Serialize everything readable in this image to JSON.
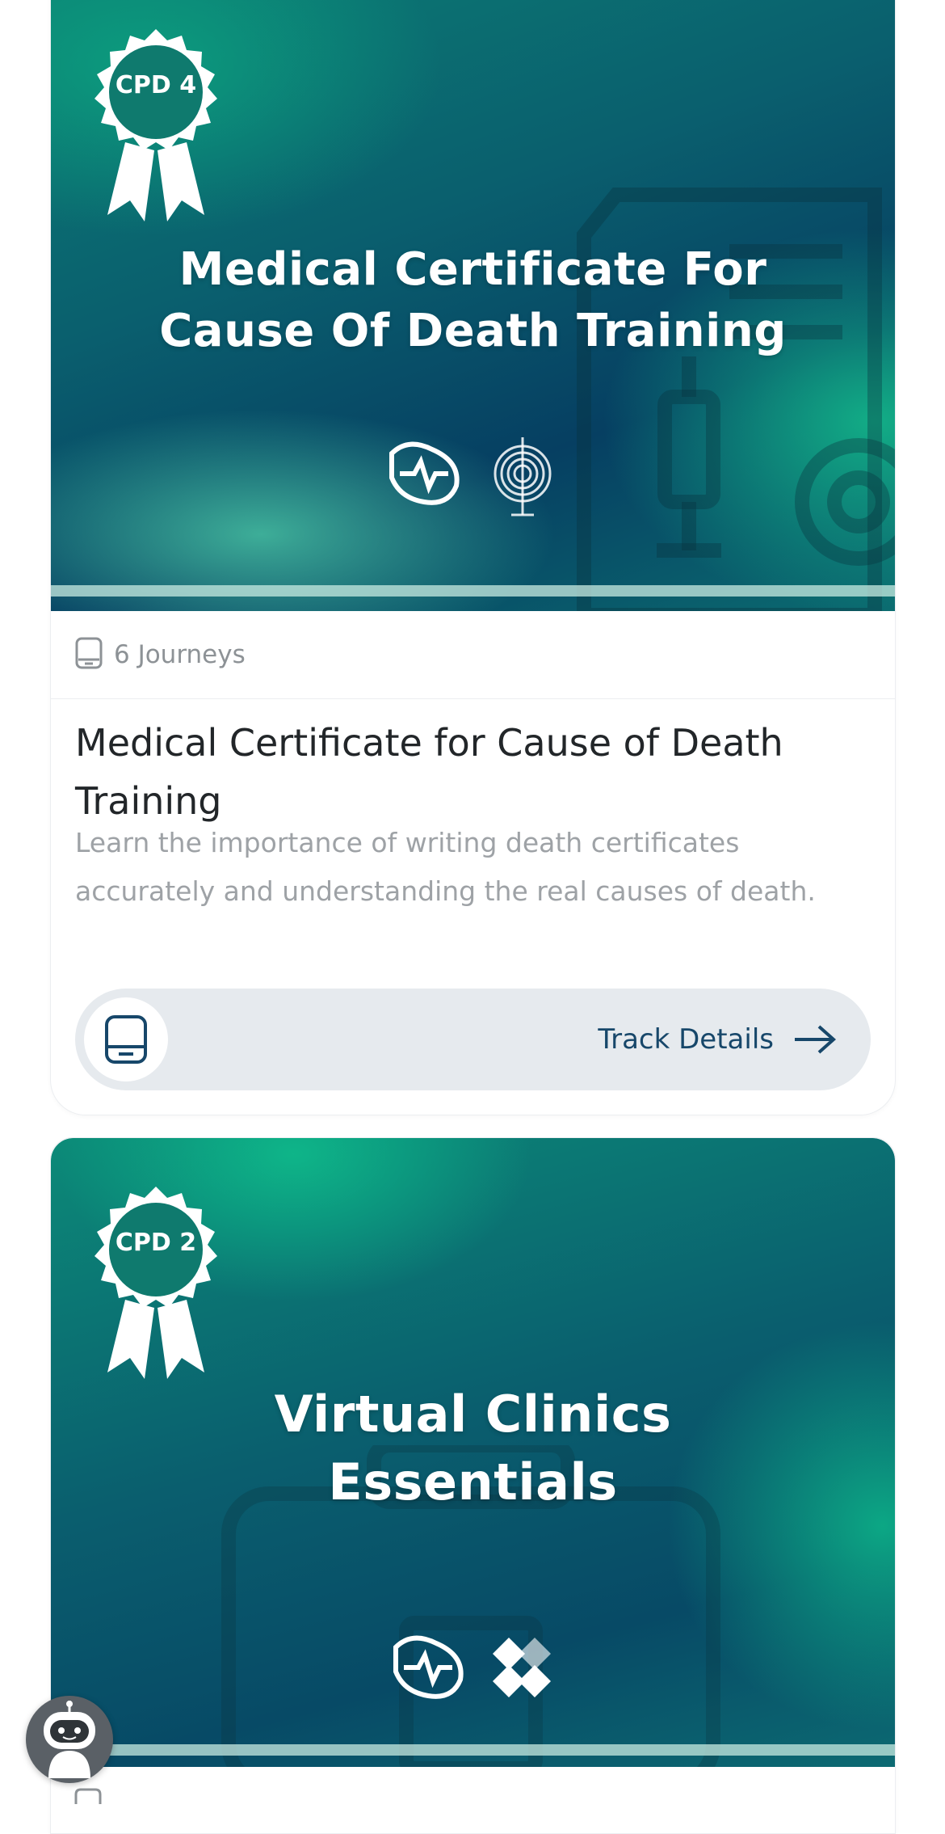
{
  "courses": [
    {
      "badge": "CPD 4",
      "banner_title": "Medical Certificate For\nCause Of Death Training",
      "journeys": "6 Journeys",
      "title": "Medical Certificate for Cause of Death Training",
      "description": "Learn the importance of writing death certificates accurately and understanding the real causes of death.",
      "cta": "Track Details"
    },
    {
      "badge": "CPD 2",
      "banner_title": "Virtual Clinics\nEssentials"
    }
  ],
  "icons": {
    "journeys": "tablet-icon",
    "track": "tablet-icon",
    "arrow": "arrow-right-icon",
    "assistant": "robot-assistant-icon"
  },
  "colors": {
    "accent": "#17476a",
    "muted_text": "#8d9296",
    "button_bg": "#e6eaee"
  }
}
